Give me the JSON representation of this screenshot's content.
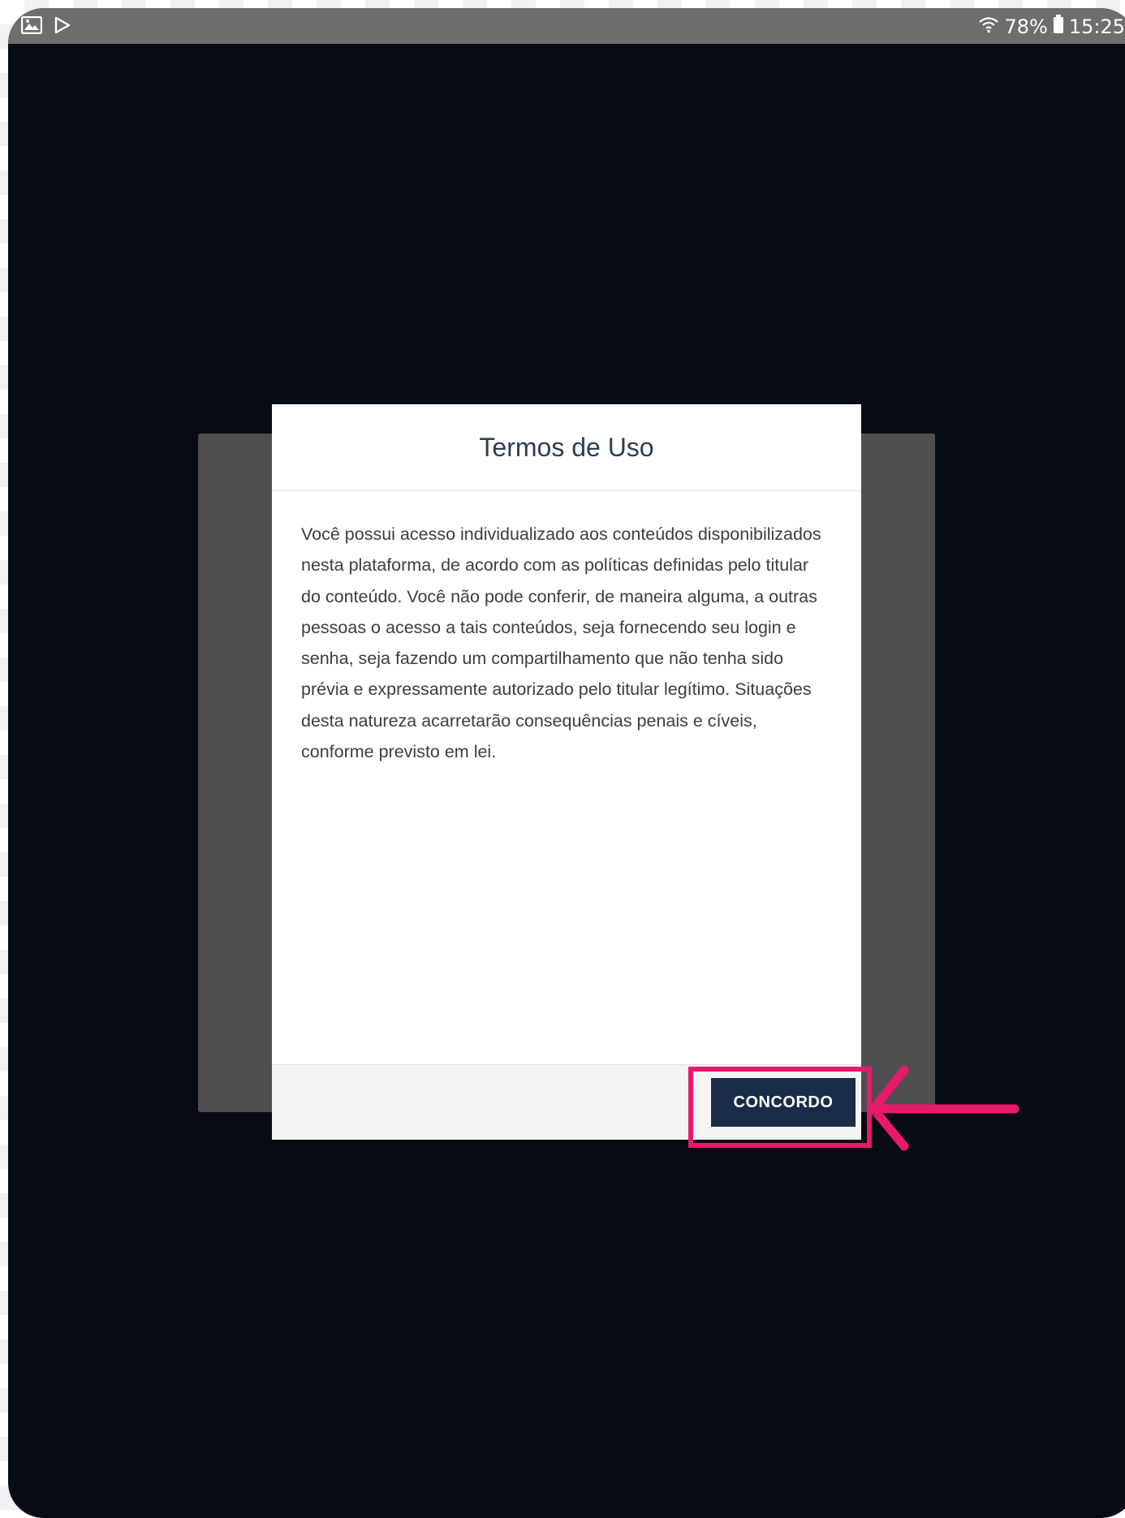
{
  "status_bar": {
    "left_icons": [
      "gallery-icon",
      "play-store-icon"
    ],
    "wifi_icon": "wifi-icon",
    "battery_percent": "78%",
    "battery_icon": "battery-icon",
    "time": "15:25"
  },
  "modal": {
    "title": "Termos de Uso",
    "body": "Você possui acesso individualizado aos conteúdos disponibilizados nesta plataforma, de acordo com as políticas definidas pelo titular do conteúdo. Você não pode conferir, de maneira alguma, a outras pessoas o acesso a tais conteúdos, seja fornecendo seu login e senha, seja fazendo um compartilhamento que não tenha sido prévia e expressamente autorizado pelo titular legítimo. Situações desta natureza acarretarão consequências penais e cíveis, conforme previsto em lei.",
    "agree_button": "CONCORDO"
  },
  "annotation": {
    "highlight_color": "#e8196b"
  },
  "colors": {
    "screen_background": "#070b13",
    "status_bar": "#6e6e6e",
    "button": "#1a2c48"
  }
}
